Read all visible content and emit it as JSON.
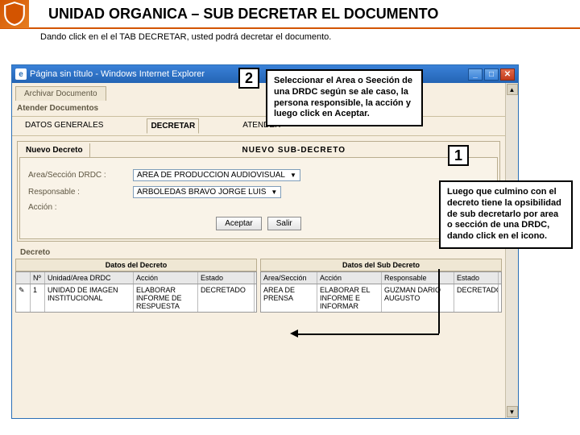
{
  "header": {
    "title": "UNIDAD ORGANICA – SUB DECRETAR EL DOCUMENTO"
  },
  "subtitle": "Dando click en el el TAB DECRETAR, usted podrá decretar el documento.",
  "ie": {
    "title": "Página sin título - Windows Internet Explorer",
    "min": "_",
    "max": "□",
    "close": "✕",
    "up": "▲",
    "down": "▼"
  },
  "app": {
    "tab1": "Archivar Documento",
    "sec1": "Atender Documentos",
    "subtabs": {
      "a": "DATOS GENERALES",
      "b": "DECRETAR",
      "c": "ATENDER"
    },
    "formLeft": "Nuevo Decreto",
    "formRight": "NUEVO SUB-DECRETO",
    "fields": {
      "areaLabel": "Area/Sección DRDC :",
      "areaValue": "AREA DE PRODUCCION AUDIOVISUAL",
      "respLabel": "Responsable :",
      "respValue": "ARBOLEDAS BRAVO JORGE LUIS",
      "accionLabel": "Acción :"
    },
    "buttons": {
      "accept": "Aceptar",
      "exit": "Salir"
    },
    "grid": {
      "decretoTitle": "Decreto",
      "leftHeader": "Datos del Decreto",
      "rightHeader": "Datos del Sub Decreto",
      "leftCols": {
        "n": "Nº",
        "u": "Unidad/Area DRDC",
        "a": "Acción",
        "e": "Estado"
      },
      "leftRow": {
        "pen": "✎",
        "n": "1",
        "u": "UNIDAD DE IMAGEN INSTITUCIONAL",
        "a": "ELABORAR INFORME DE RESPUESTA",
        "e": "DECRETADO"
      },
      "rightCols": {
        "as": "Area/Sección",
        "ac": "Acción",
        "r": "Responsable",
        "es": "Estado"
      },
      "rightRow": {
        "as": "AREA DE PRENSA",
        "ac": "ELABORAR EL INFORME E INFORMAR",
        "r": "GUZMAN DARIO AUGUSTO",
        "es": "DECRETADO"
      }
    }
  },
  "callouts": {
    "num2": "2",
    "box2": "Seleccionar el Area o Seeción de una DRDC según se ale caso, la persona responsible, la acción y luego click en Aceptar.",
    "num1": "1",
    "box1": "Luego que culmino con el decreto tiene la opsibilidad de sub decretarlo por area o sección de una DRDC, dando click en el icono."
  }
}
